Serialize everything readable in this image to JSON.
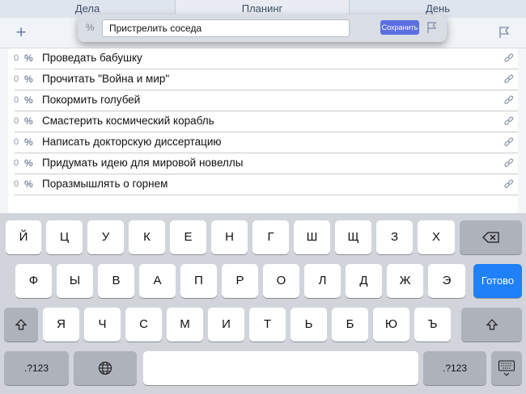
{
  "tabs": [
    {
      "label": "Дела"
    },
    {
      "label": "Планинг"
    },
    {
      "label": "День"
    }
  ],
  "toolbar": {
    "plus_label": "+"
  },
  "popup": {
    "percent_label": "%",
    "input_value": "Пристрелить соседа",
    "save_label": "Сохранить"
  },
  "tasks": [
    {
      "count": "0",
      "pct": "%",
      "title": "Проведать бабушку"
    },
    {
      "count": "0",
      "pct": "%",
      "title": "Прочитать \"Война и мир\""
    },
    {
      "count": "0",
      "pct": "%",
      "title": "Покормить голубей"
    },
    {
      "count": "0",
      "pct": "%",
      "title": "Смастерить космический корабль"
    },
    {
      "count": "0",
      "pct": "%",
      "title": "Написать докторскую диссертацию"
    },
    {
      "count": "0",
      "pct": "%",
      "title": "Придумать идею для мировой новеллы"
    },
    {
      "count": "0",
      "pct": "%",
      "title": "Поразмышлять о горнем"
    }
  ],
  "keyboard": {
    "row1": [
      "Й",
      "Ц",
      "У",
      "К",
      "Е",
      "Н",
      "Г",
      "Ш",
      "Щ",
      "З",
      "Х"
    ],
    "row2": [
      "Ф",
      "Ы",
      "В",
      "А",
      "П",
      "Р",
      "О",
      "Л",
      "Д",
      "Ж",
      "Э"
    ],
    "row3": [
      "Я",
      "Ч",
      "С",
      "М",
      "И",
      "Т",
      "Ь",
      "Б",
      "Ю",
      "Ъ"
    ],
    "done_label": "Готово",
    "numbers_label": ".?123",
    "icons": {
      "backspace": "backspace-icon",
      "shift": "shift-icon",
      "globe": "globe-icon",
      "hide": "keyboard-hide-icon"
    }
  },
  "colors": {
    "accent_blue": "#1f80f8",
    "save_button": "#5b6fe0",
    "keyboard_bg": "#d1d5db"
  }
}
